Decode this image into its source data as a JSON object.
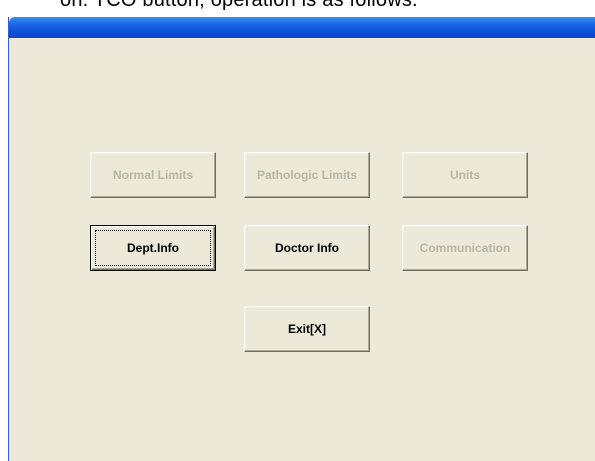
{
  "caption": {
    "text": "on. TCO button, operation is as follows."
  },
  "window": {
    "titlebar_color": "#0a52d8",
    "background_color": "#ece9d8"
  },
  "buttons": {
    "normal_limits": {
      "label": "Normal Limits",
      "enabled": false
    },
    "pathologic_limits": {
      "label": "Pathologic Limits",
      "enabled": false
    },
    "units": {
      "label": "Units",
      "enabled": false
    },
    "dept_info": {
      "label": "Dept.Info",
      "enabled": true,
      "focused": true
    },
    "doctor_info": {
      "label": "Doctor Info",
      "enabled": true
    },
    "communication": {
      "label": "Communication",
      "enabled": false
    },
    "exit": {
      "label": "Exit[X]",
      "enabled": true
    }
  }
}
